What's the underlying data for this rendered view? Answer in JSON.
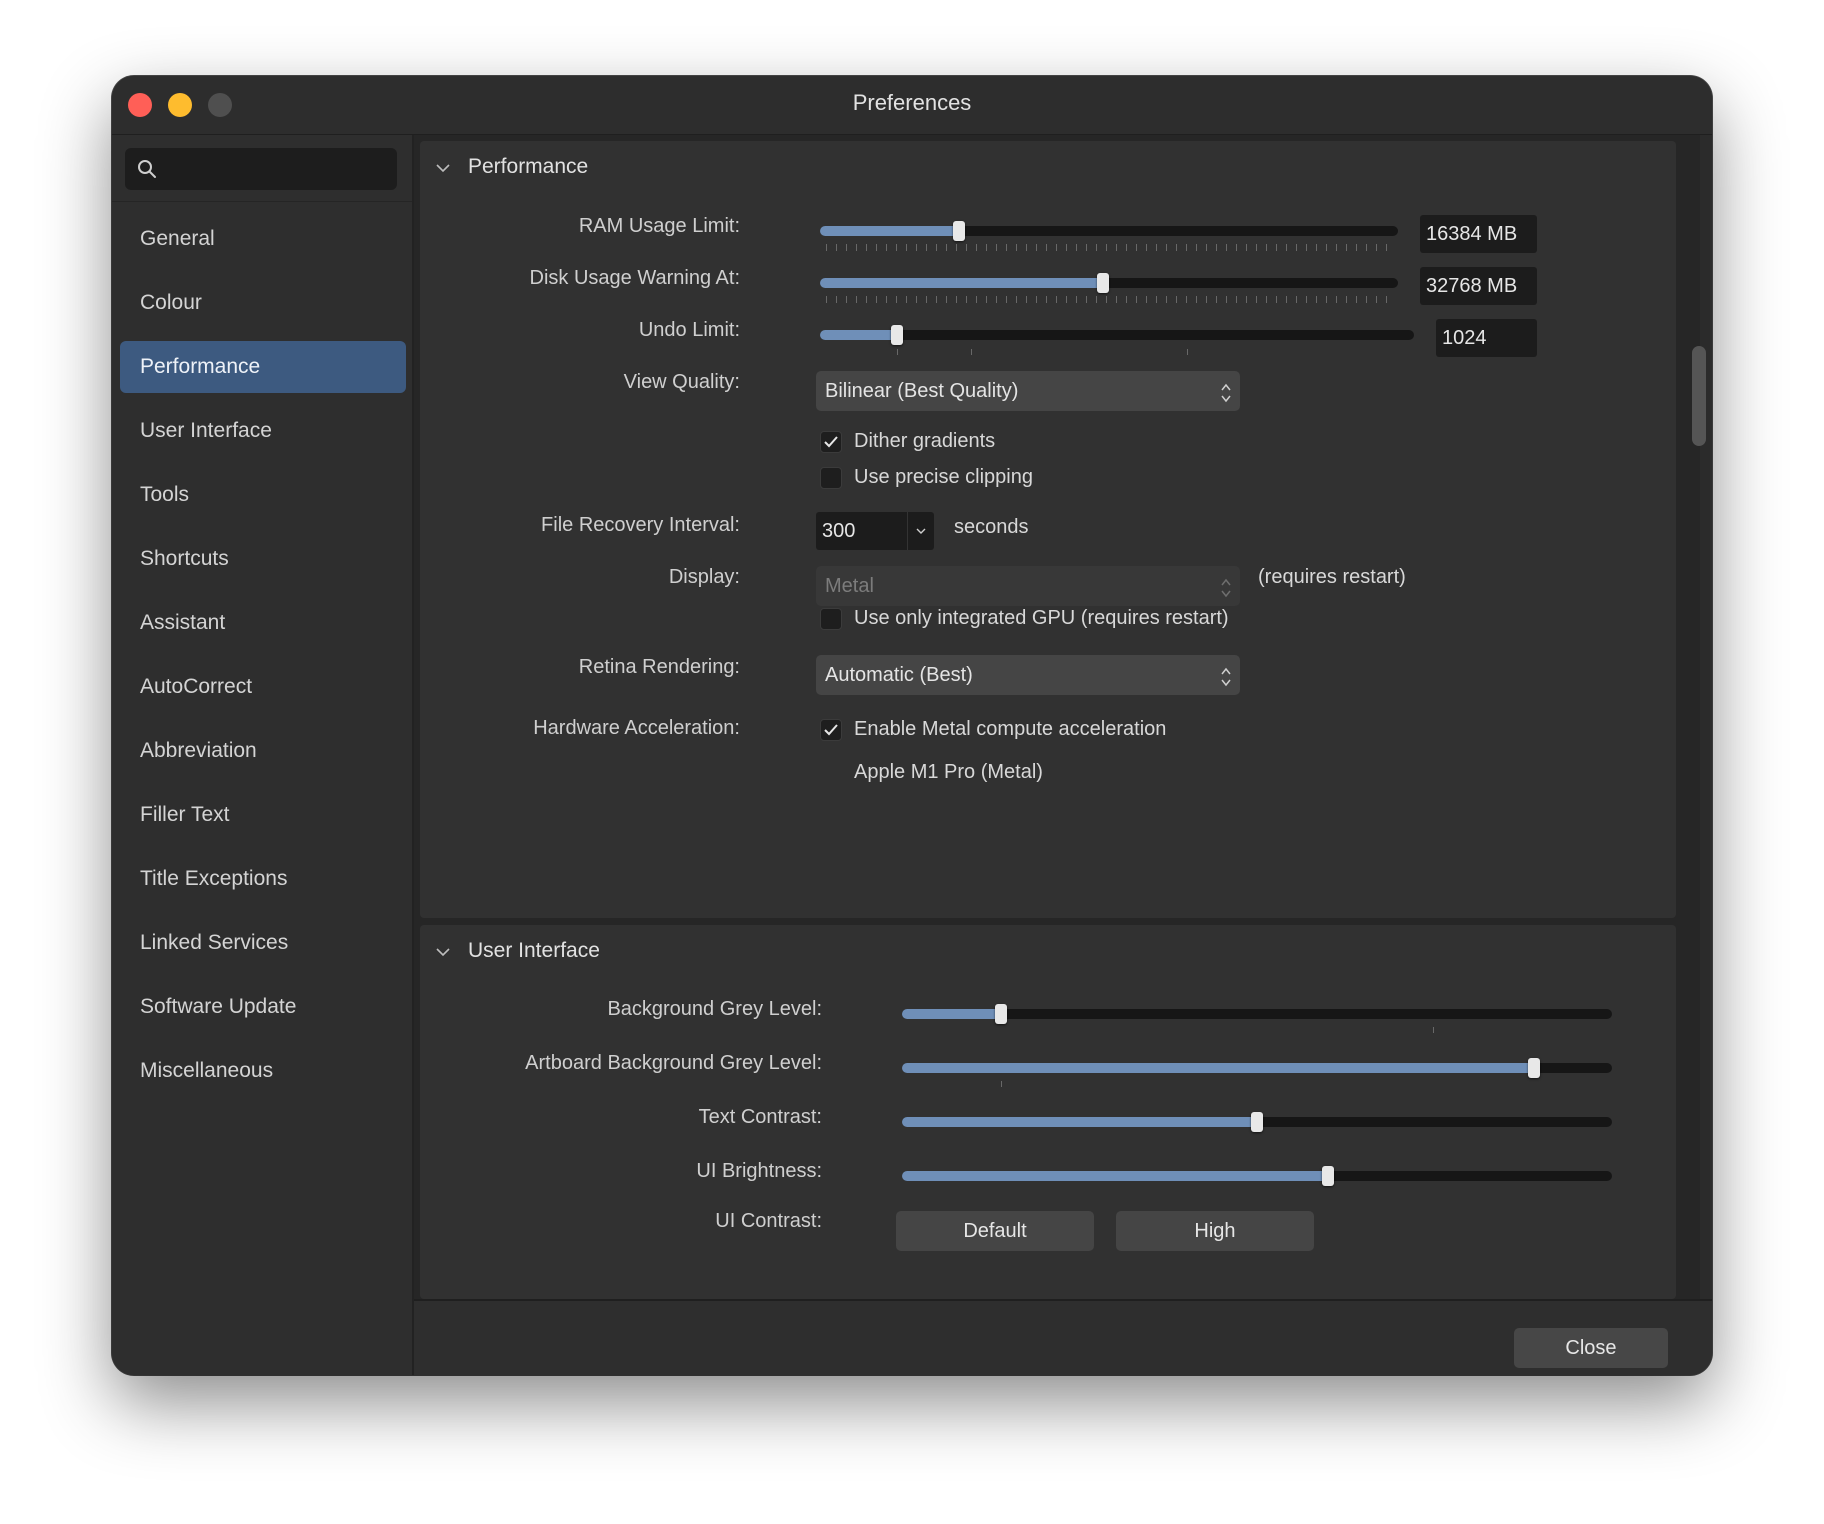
{
  "window": {
    "title": "Preferences"
  },
  "search": {
    "placeholder": ""
  },
  "sidebar": {
    "items": [
      {
        "label": "General",
        "active": false
      },
      {
        "label": "Colour",
        "active": false
      },
      {
        "label": "Performance",
        "active": true
      },
      {
        "label": "User Interface",
        "active": false
      },
      {
        "label": "Tools",
        "active": false
      },
      {
        "label": "Shortcuts",
        "active": false
      },
      {
        "label": "Assistant",
        "active": false
      },
      {
        "label": "AutoCorrect",
        "active": false
      },
      {
        "label": "Abbreviation",
        "active": false
      },
      {
        "label": "Filler Text",
        "active": false
      },
      {
        "label": "Title Exceptions",
        "active": false
      },
      {
        "label": "Linked Services",
        "active": false
      },
      {
        "label": "Software Update",
        "active": false
      },
      {
        "label": "Miscellaneous",
        "active": false
      }
    ]
  },
  "performance": {
    "title": "Performance",
    "ram": {
      "label": "RAM Usage Limit:",
      "value": "16384 MB",
      "level": 0.24
    },
    "disk": {
      "label": "Disk Usage Warning At:",
      "value": "32768 MB",
      "level": 0.49
    },
    "undo": {
      "label": "Undo Limit:",
      "value": "1024",
      "level": 0.13
    },
    "view_quality": {
      "label": "View Quality:",
      "value": "Bilinear (Best Quality)"
    },
    "dither": {
      "label": "Dither gradients",
      "checked": true
    },
    "precise_clipping": {
      "label": "Use precise clipping",
      "checked": false
    },
    "recovery": {
      "label": "File Recovery Interval:",
      "value": "300",
      "unit": "seconds"
    },
    "display": {
      "label": "Display:",
      "value": "Metal",
      "note": "(requires restart)"
    },
    "integrated_gpu": {
      "label": "Use only integrated GPU (requires restart)",
      "checked": false
    },
    "retina": {
      "label": "Retina Rendering:",
      "value": "Automatic (Best)"
    },
    "hw_accel": {
      "label": "Hardware Acceleration:",
      "option": "Enable Metal compute acceleration",
      "checked": true,
      "device": "Apple M1 Pro (Metal)"
    }
  },
  "user_interface": {
    "title": "User Interface",
    "bg_grey": {
      "label": "Background Grey Level:",
      "level": 0.14
    },
    "artboard_grey": {
      "label": "Artboard Background Grey Level:",
      "level": 0.89
    },
    "text_contrast": {
      "label": "Text Contrast:",
      "level": 0.5
    },
    "ui_brightness": {
      "label": "UI Brightness:",
      "level": 0.6
    },
    "ui_contrast": {
      "label": "UI Contrast:",
      "options": [
        "Default",
        "High"
      ]
    }
  },
  "footer": {
    "close_label": "Close"
  },
  "colors": {
    "accent": "#3d5a80",
    "slider_fill": "#6f8fb8",
    "close": "#ff5f57",
    "minimize": "#febc2e"
  }
}
